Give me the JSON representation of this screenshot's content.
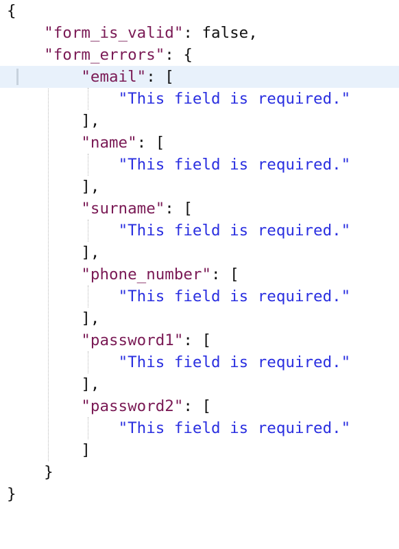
{
  "json_doc": {
    "open_root": "{",
    "close_root": "}",
    "form_is_valid_key": "\"form_is_valid\"",
    "form_is_valid_value": "false",
    "form_errors_key": "\"form_errors\"",
    "fields": [
      {
        "key": "\"email\"",
        "message": "\"This field is required.\""
      },
      {
        "key": "\"name\"",
        "message": "\"This field is required.\""
      },
      {
        "key": "\"surname\"",
        "message": "\"This field is required.\""
      },
      {
        "key": "\"phone_number\"",
        "message": "\"This field is required.\""
      },
      {
        "key": "\"password1\"",
        "message": "\"This field is required.\""
      },
      {
        "key": "\"password2\"",
        "message": "\"This field is required.\""
      }
    ]
  },
  "colors": {
    "key": "#7a1a55",
    "string": "#2a2fe0",
    "text": "#111111",
    "current_line": "#e8f1fb"
  }
}
